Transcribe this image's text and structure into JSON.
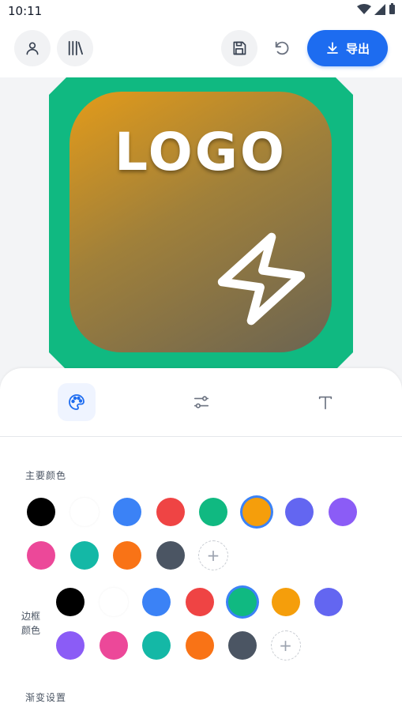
{
  "status": {
    "time": "10:11"
  },
  "toolbar": {
    "profile_icon": "user-icon",
    "library_icon": "library-icon",
    "save_icon": "save-icon",
    "undo_icon": "undo-icon",
    "export_label": "导出"
  },
  "canvas": {
    "logo_text": "LOGO",
    "frame_color": "#10b981",
    "gradient_from": "#e39b1a",
    "gradient_to": "#6b6452",
    "symbol": "lightning-icon"
  },
  "tabs": [
    {
      "icon": "palette-icon",
      "active": true
    },
    {
      "icon": "sliders-icon",
      "active": false
    },
    {
      "icon": "text-icon",
      "active": false
    }
  ],
  "main_color": {
    "label": "主要颜色",
    "colors": [
      "#000000",
      "#ffffff",
      "#3b82f6",
      "#ef4444",
      "#10b981",
      "#f59e0b",
      "#6366f1",
      "#8b5cf6",
      "#ec4899",
      "#14b8a6",
      "#f97316",
      "#4b5563"
    ],
    "selected": "#f59e0b",
    "add_label": "+"
  },
  "border_color": {
    "label_line1": "边框",
    "label_line2": "颜色",
    "colors": [
      "#000000",
      "#ffffff",
      "#3b82f6",
      "#ef4444",
      "#10b981",
      "#f59e0b",
      "#6366f1",
      "#8b5cf6",
      "#ec4899",
      "#14b8a6",
      "#f97316",
      "#4b5563"
    ],
    "selected": "#10b981",
    "add_label": "+"
  },
  "gradient": {
    "label": "渐变设置"
  }
}
